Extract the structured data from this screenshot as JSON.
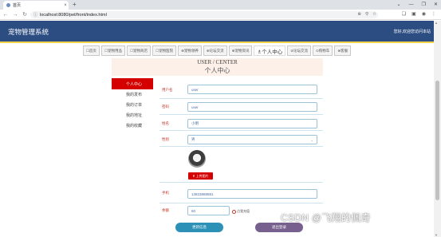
{
  "browser": {
    "tab_title": "首页",
    "tab_close": "×",
    "new_tab": "+",
    "window_controls": [
      "⌄",
      "—",
      "❐",
      "✕"
    ],
    "nav": {
      "back": "←",
      "forward": "→",
      "reload": "↻"
    },
    "url_lock_icon": "ⓘ",
    "url": "localhost:8080/pet/front/index.html",
    "url_actions": [
      "⊕",
      "⚲",
      "☆"
    ],
    "toolbar_icons": [
      "❏",
      "▣",
      "◉",
      "⋮"
    ]
  },
  "header": {
    "brand": "宠物管理系统",
    "welcome": "您好,欢迎您访问本站",
    "colors": {
      "bar": "#2c4d82",
      "stripe": "#f2d34a"
    }
  },
  "nav": {
    "items": [
      {
        "label": "☐首页",
        "active": false
      },
      {
        "label": "☐宠物用品",
        "active": false
      },
      {
        "label": "☐宠物商店",
        "active": false
      },
      {
        "label": "☐宠物医院",
        "active": false
      },
      {
        "label": "⊕宠物领养",
        "active": false
      },
      {
        "label": "⊕论坛交流",
        "active": false
      },
      {
        "label": "⊕宠物资讯",
        "active": false
      },
      {
        "label": "♗个人中心",
        "active": true
      },
      {
        "label": "⊘论坛交流",
        "active": false
      },
      {
        "label": "⊙购物车",
        "active": false
      },
      {
        "label": "⊗客服",
        "active": false
      }
    ]
  },
  "page_title": {
    "en": "USER / CENTER",
    "cn": "个人中心"
  },
  "sidebar": {
    "items": [
      {
        "label": "个人中心",
        "active": true
      },
      {
        "label": "我的发布",
        "active": false
      },
      {
        "label": "我的订单",
        "active": false
      },
      {
        "label": "我的地址",
        "active": false
      },
      {
        "label": "我的收藏",
        "active": false
      }
    ]
  },
  "form": {
    "username": {
      "label": "用户名",
      "value": "user"
    },
    "password": {
      "label": "密码",
      "value": "user"
    },
    "name": {
      "label": "姓名",
      "value": "小明"
    },
    "gender": {
      "label": "性别",
      "value": "男",
      "caret": "⌄"
    },
    "upload_label": "上传图片",
    "upload_icon": "⬆",
    "phone": {
      "label": "手机",
      "value": "13823888881"
    },
    "balance": {
      "label": "余额",
      "value": "60",
      "recharge_label": "点我充值"
    }
  },
  "buttons": {
    "update": "更新信息",
    "logout": "退出登录"
  },
  "scrollbar": {
    "up": "▲",
    "down": "▼"
  },
  "watermark": "CSDN @飞翔的佩奇",
  "colors": {
    "accent_red": "#d40000",
    "update_btn": "#2d91b7",
    "logout_btn": "#77608e"
  }
}
